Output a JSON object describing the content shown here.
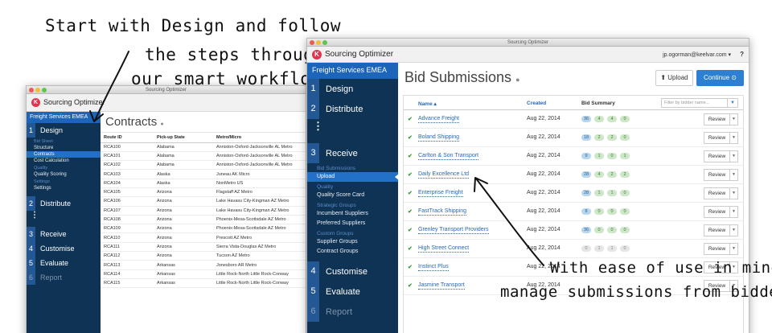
{
  "annotations": {
    "top_line1": "Start with Design and follow",
    "top_line2": "the steps through",
    "top_line3": "our smart workflow",
    "bottom_line1": "With ease of use in mind,",
    "bottom_line2": "manage submissions from bidders"
  },
  "left_window": {
    "titlebar": "Sourcing Optimizer",
    "app_name": "Sourcing Optimizer",
    "sidebar_title": "Freight Services EMEA",
    "steps": {
      "design": {
        "num": "1",
        "label": "Design"
      },
      "distribute": {
        "num": "2",
        "label": "Distribute"
      },
      "receive": {
        "num": "3",
        "label": "Receive"
      },
      "customise": {
        "num": "4",
        "label": "Customise"
      },
      "evaluate": {
        "num": "5",
        "label": "Evaluate"
      },
      "report": {
        "num": "6",
        "label": "Report"
      }
    },
    "design_sub": {
      "group_bid_sheet": "Bid Sheet",
      "structure": "Structure",
      "contracts": "Contracts",
      "cost_calculation": "Cost Calculation",
      "group_quality": "Quality",
      "quality_scoring": "Quality Scoring",
      "group_settings": "Settings",
      "settings": "Settings"
    },
    "page_title": "Contracts",
    "columns": [
      "Route ID",
      "Pick-up State",
      "Metro/Micro"
    ],
    "rows": [
      [
        "RCA100",
        "Alabama",
        "Anniston-Oxford-Jacksonville AL Metro"
      ],
      [
        "RCA101",
        "Alabama",
        "Anniston-Oxford-Jacksonville AL Metro"
      ],
      [
        "RCA102",
        "Alabama",
        "Anniston-Oxford-Jacksonville AL Metro"
      ],
      [
        "RCA103",
        "Alaska",
        "Juneau AK Micro"
      ],
      [
        "RCA104",
        "Alaska",
        "NonMetro US"
      ],
      [
        "RCA105",
        "Arizona",
        "Flagstaff AZ Metro"
      ],
      [
        "RCA106",
        "Arizona",
        "Lake Havasu City-Kingman AZ Metro"
      ],
      [
        "RCA107",
        "Arizona",
        "Lake Havasu City-Kingman AZ Metro"
      ],
      [
        "RCA108",
        "Arizona",
        "Phoenix-Mesa-Scottsdale AZ Metro"
      ],
      [
        "RCA109",
        "Arizona",
        "Phoenix-Mesa-Scottsdale AZ Metro"
      ],
      [
        "RCA110",
        "Arizona",
        "Prescott AZ Metro"
      ],
      [
        "RCA111",
        "Arizona",
        "Sierra Vista-Douglas AZ Metro"
      ],
      [
        "RCA112",
        "Arizona",
        "Tucson AZ Metro"
      ],
      [
        "RCA113",
        "Arkansas",
        "Jonesboro AR Metro"
      ],
      [
        "RCA114",
        "Arkansas",
        "Little Rock-North Little Rock-Conway"
      ],
      [
        "RCA115",
        "Arkansas",
        "Little Rock-North Little Rock-Conway"
      ]
    ]
  },
  "right_window": {
    "titlebar": "Sourcing Optimizer",
    "app_name": "Sourcing Optimizer",
    "user": "jp.ogorman@keelvar.com ▾",
    "help": "?",
    "sidebar_title": "Freight Services EMEA",
    "steps": {
      "design": {
        "num": "1",
        "label": "Design"
      },
      "distribute": {
        "num": "2",
        "label": "Distribute"
      },
      "receive": {
        "num": "3",
        "label": "Receive"
      },
      "customise": {
        "num": "4",
        "label": "Customise"
      },
      "evaluate": {
        "num": "5",
        "label": "Evaluate"
      },
      "report": {
        "num": "6",
        "label": "Report"
      }
    },
    "receive_sub": {
      "group_bid_submissions": "Bid Submissions",
      "upload": "Upload",
      "group_quality": "Quality",
      "quality_score_card": "Quality Score Card",
      "group_strategic": "Strategic Groups",
      "incumbent_suppliers": "Incumbent Suppliers",
      "preferred_suppliers": "Preferred Suppliers",
      "group_custom": "Custom Groups",
      "supplier_groups": "Supplier Groups",
      "contract_groups": "Contract Groups"
    },
    "page_title": "Bid Submissions",
    "upload_label": "Upload",
    "continue_label": "Continue",
    "col_name": "Name ▴",
    "col_created": "Created",
    "col_summary": "Bid Summary",
    "filter_placeholder": "Filter by bidder name...",
    "review_label": "Review",
    "rows": [
      {
        "name": "Advance Freight",
        "date": "Aug 22, 2014",
        "pills": [
          "36",
          "4",
          "4",
          "0"
        ]
      },
      {
        "name": "Boland Shipping",
        "date": "Aug 22, 2014",
        "pills": [
          "18",
          "2",
          "2",
          "0"
        ]
      },
      {
        "name": "Carlton & Son Transport",
        "date": "Aug 22, 2014",
        "pills": [
          "9",
          "1",
          "0",
          "1"
        ]
      },
      {
        "name": "Daily Excellence Ltd",
        "date": "Aug 22, 2014",
        "pills": [
          "28",
          "4",
          "2",
          "2"
        ]
      },
      {
        "name": "Enterprise Freight",
        "date": "Aug 22, 2014",
        "pills": [
          "28",
          "1",
          "1",
          "0"
        ]
      },
      {
        "name": "FastTrack Shipping",
        "date": "Aug 22, 2014",
        "pills": [
          "8",
          "0",
          "0",
          "0"
        ]
      },
      {
        "name": "Grenley Transport Providers",
        "date": "Aug 22, 2014",
        "pills": [
          "36",
          "0",
          "0",
          "0"
        ]
      },
      {
        "name": "High Street Connect",
        "date": "Aug 22, 2014",
        "pills": [
          "0",
          "1",
          "1",
          "0"
        ]
      },
      {
        "name": "Instinct Plus",
        "date": "Aug 22, 2014",
        "pills": [
          "",
          "",
          "",
          ""
        ]
      },
      {
        "name": "Jasmine Transport",
        "date": "Aug 22, 2014",
        "pills": [
          "",
          "",
          "",
          ""
        ]
      }
    ]
  }
}
